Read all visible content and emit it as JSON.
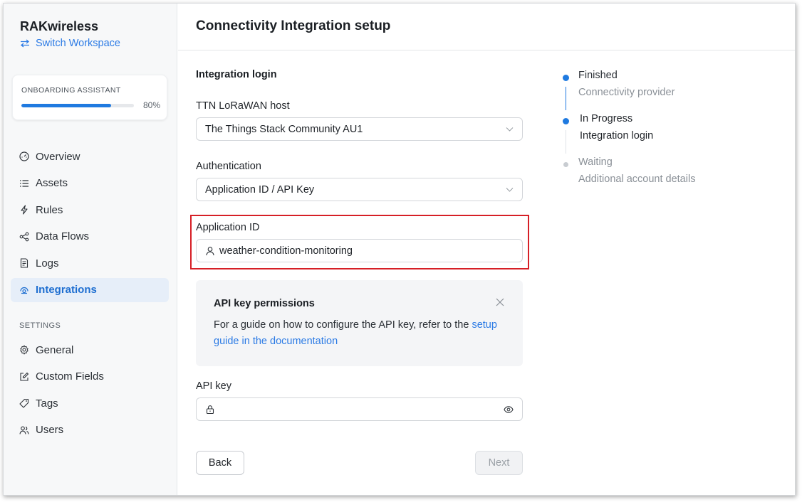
{
  "sidebar": {
    "brand": "RAKwireless",
    "switch_workspace": "Switch Workspace",
    "onboarding": {
      "label": "ONBOARDING ASSISTANT",
      "progress_text": "80%",
      "progress": 0.8
    },
    "nav": [
      {
        "label": "Overview",
        "icon": "gauge-icon"
      },
      {
        "label": "Assets",
        "icon": "list-icon"
      },
      {
        "label": "Rules",
        "icon": "lightning-icon"
      },
      {
        "label": "Data Flows",
        "icon": "share-icon"
      },
      {
        "label": "Logs",
        "icon": "log-file-icon"
      },
      {
        "label": "Integrations",
        "icon": "integrations-icon",
        "active": true
      }
    ],
    "settings_heading": "SETTINGS",
    "settings": [
      {
        "label": "General",
        "icon": "gear-icon"
      },
      {
        "label": "Custom Fields",
        "icon": "edit-icon"
      },
      {
        "label": "Tags",
        "icon": "tag-icon"
      },
      {
        "label": "Users",
        "icon": "users-icon"
      }
    ]
  },
  "main": {
    "title": "Connectivity Integration setup",
    "section_title": "Integration login",
    "host": {
      "label": "TTN LoRaWAN host",
      "value": "The Things Stack Community AU1"
    },
    "auth": {
      "label": "Authentication",
      "value": "Application ID / API Key"
    },
    "app_id": {
      "label": "Application ID",
      "value": "weather-condition-monitoring"
    },
    "callout": {
      "title": "API key permissions",
      "body": "For a guide on how to configure the API key, refer to the",
      "link": "setup guide in the documentation"
    },
    "api_key": {
      "label": "API key",
      "value": ""
    },
    "back_label": "Back",
    "next_label": "Next"
  },
  "stepper": [
    {
      "status": "Finished",
      "name": "Connectivity provider",
      "state": "done"
    },
    {
      "status": "In Progress",
      "name": "Integration login",
      "state": "current"
    },
    {
      "status": "Waiting",
      "name": "Additional account details",
      "state": "waiting"
    }
  ],
  "colors": {
    "accent": "#1f7ae0",
    "highlight": "#d61f26"
  }
}
